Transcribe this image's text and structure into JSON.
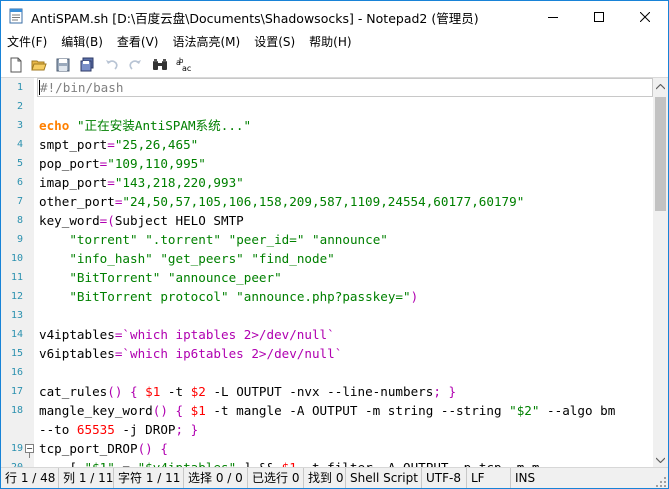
{
  "window": {
    "title": "AntiSPAM.sh [D:\\百度云盘\\Documents\\Shadowsocks] - Notepad2 (管理员)"
  },
  "menu": [
    "文件(F)",
    "编辑(B)",
    "查看(V)",
    "语法高亮(M)",
    "设置(S)",
    "帮助(H)"
  ],
  "toolbar": {
    "buttons": [
      "new-file-icon",
      "open-folder-icon",
      "save-icon",
      "save-all-icon",
      "undo-icon",
      "redo-icon",
      "find-icon",
      "replace-icon"
    ]
  },
  "editor": {
    "lines": [
      {
        "n": "1",
        "segs": [
          [
            "c-cmt",
            "#!/bin/bash"
          ]
        ]
      },
      {
        "n": "2",
        "segs": []
      },
      {
        "n": "3",
        "segs": [
          [
            "c-kw",
            "echo"
          ],
          [
            "",
            " "
          ],
          [
            "c-str",
            "\"正在安装AntiSPAM系统...\""
          ]
        ]
      },
      {
        "n": "4",
        "segs": [
          [
            "",
            "smpt_port"
          ],
          [
            "c-op",
            "="
          ],
          [
            "c-str",
            "\"25,26,465\""
          ]
        ]
      },
      {
        "n": "5",
        "segs": [
          [
            "",
            "pop_port"
          ],
          [
            "c-op",
            "="
          ],
          [
            "c-str",
            "\"109,110,995\""
          ]
        ]
      },
      {
        "n": "6",
        "segs": [
          [
            "",
            "imap_port"
          ],
          [
            "c-op",
            "="
          ],
          [
            "c-str",
            "\"143,218,220,993\""
          ]
        ]
      },
      {
        "n": "7",
        "segs": [
          [
            "",
            "other_port"
          ],
          [
            "c-op",
            "="
          ],
          [
            "c-str",
            "\"24,50,57,105,106,158,209,587,1109,24554,60177,60179\""
          ]
        ]
      },
      {
        "n": "8",
        "segs": [
          [
            "",
            "key_word"
          ],
          [
            "c-op",
            "=("
          ],
          [
            "",
            "Subject HELO SMTP"
          ]
        ]
      },
      {
        "n": "9",
        "segs": [
          [
            "",
            "    "
          ],
          [
            "c-str",
            "\"torrent\""
          ],
          [
            "",
            " "
          ],
          [
            "c-str",
            "\".torrent\""
          ],
          [
            "",
            " "
          ],
          [
            "c-str",
            "\"peer_id=\""
          ],
          [
            "",
            " "
          ],
          [
            "c-str",
            "\"announce\""
          ]
        ]
      },
      {
        "n": "10",
        "segs": [
          [
            "",
            "    "
          ],
          [
            "c-str",
            "\"info_hash\""
          ],
          [
            "",
            " "
          ],
          [
            "c-str",
            "\"get_peers\""
          ],
          [
            "",
            " "
          ],
          [
            "c-str",
            "\"find_node\""
          ]
        ]
      },
      {
        "n": "11",
        "segs": [
          [
            "",
            "    "
          ],
          [
            "c-str",
            "\"BitTorrent\""
          ],
          [
            "",
            " "
          ],
          [
            "c-str",
            "\"announce_peer\""
          ]
        ]
      },
      {
        "n": "12",
        "segs": [
          [
            "",
            "    "
          ],
          [
            "c-str",
            "\"BitTorrent protocol\""
          ],
          [
            "",
            " "
          ],
          [
            "c-str",
            "\"announce.php?passkey=\""
          ],
          [
            "c-op",
            ")"
          ]
        ]
      },
      {
        "n": "13",
        "segs": []
      },
      {
        "n": "14",
        "segs": [
          [
            "",
            "v4iptables"
          ],
          [
            "c-op",
            "="
          ],
          [
            "c-bq",
            "`which iptables 2>/dev/null`"
          ]
        ]
      },
      {
        "n": "15",
        "segs": [
          [
            "",
            "v6iptables"
          ],
          [
            "c-op",
            "="
          ],
          [
            "c-bq",
            "`which ip6tables 2>/dev/null`"
          ]
        ]
      },
      {
        "n": "16",
        "segs": []
      },
      {
        "n": "17",
        "segs": [
          [
            "",
            "cat_rules"
          ],
          [
            "c-op",
            "() { "
          ],
          [
            "c-cmd",
            "$1"
          ],
          [
            "",
            " -t "
          ],
          [
            "c-cmd",
            "$2"
          ],
          [
            "",
            " -L OUTPUT -nvx --line-numbers"
          ],
          [
            "c-op",
            "; }"
          ]
        ]
      },
      {
        "n": "18",
        "segs": [
          [
            "",
            "mangle_key_word"
          ],
          [
            "c-op",
            "() { "
          ],
          [
            "c-cmd",
            "$1"
          ],
          [
            "",
            " -t mangle -A OUTPUT -m string --string "
          ],
          [
            "c-str",
            "\"$2\""
          ],
          [
            "",
            " --algo bm"
          ]
        ]
      },
      {
        "n": "",
        "segs": [
          [
            "",
            "--to "
          ],
          [
            "c-num",
            "65535"
          ],
          [
            "",
            " -j DROP"
          ],
          [
            "c-op",
            "; }"
          ]
        ]
      },
      {
        "n": "19",
        "segs": [
          [
            "",
            "tcp_port_DROP"
          ],
          [
            "c-op",
            "() {"
          ]
        ],
        "fold": true
      },
      {
        "n": "20",
        "segs": [
          [
            "",
            "    [ "
          ],
          [
            "c-str",
            "\"$1\""
          ],
          [
            "",
            " = "
          ],
          [
            "c-str",
            "\"$v4iptables\""
          ],
          [
            "",
            " ] && "
          ],
          [
            "c-cmd",
            "$1"
          ],
          [
            "",
            " -t filter -A OUTPUT -p tcp -m m"
          ]
        ]
      }
    ]
  },
  "status": {
    "line": "行 1 / 48",
    "col": "列 1 / 11",
    "char": "字符 1 / 11",
    "sel": "选择 0 / 0",
    "selected": "已选行 0",
    "found": "找到 0",
    "lexer": "Shell Script",
    "encoding": "UTF-8",
    "eol": "LF",
    "mode": "INS"
  }
}
